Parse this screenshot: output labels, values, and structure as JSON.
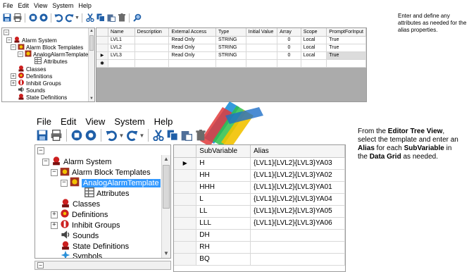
{
  "menu": [
    "File",
    "Edit",
    "View",
    "System",
    "Help"
  ],
  "toolbar": {
    "icons": [
      "save-icon",
      "print-icon",
      "stop-icon",
      "record-icon",
      "undo-icon",
      "redo-icon",
      "cut-icon",
      "copy-icon",
      "paste-icon",
      "delete-icon",
      "find-icon"
    ]
  },
  "top": {
    "tree": {
      "items": [
        {
          "label": "Alarm System",
          "icon": "alarm-icon"
        },
        {
          "label": "Alarm Block Templates",
          "icon": "template-folder-icon"
        },
        {
          "label": "AnalogAlarmTemplate",
          "icon": "template-icon"
        },
        {
          "label": "Attributes",
          "icon": "table-icon"
        },
        {
          "label": "Classes",
          "icon": "alarm-icon"
        },
        {
          "label": "Definitions",
          "icon": "definition-icon"
        },
        {
          "label": "Inhibit Groups",
          "icon": "inhibit-icon"
        },
        {
          "label": "Sounds",
          "icon": "speaker-icon"
        },
        {
          "label": "State Definitions",
          "icon": "state-icon"
        }
      ]
    },
    "grid": {
      "columns": [
        "Name",
        "Description",
        "External Access",
        "Type",
        "Initial Value",
        "Array",
        "Scope",
        "PromptForInput"
      ],
      "rows": [
        [
          "LVL1",
          "",
          "Read Only",
          "STRING",
          "",
          "0",
          "Local",
          "True"
        ],
        [
          "LVL2",
          "",
          "Read Only",
          "STRING",
          "",
          "0",
          "Local",
          "True"
        ],
        [
          "LVL3",
          "",
          "Read Only",
          "STRING",
          "",
          "0",
          "Local",
          "True"
        ]
      ],
      "current_row_marker": "▶",
      "new_row_marker": "✱"
    },
    "note": "Enter and define any attributes as needed for the alias properties."
  },
  "bottom": {
    "tree": {
      "items": [
        {
          "label": "Alarm System",
          "icon": "alarm-icon"
        },
        {
          "label": "Alarm Block Templates",
          "icon": "template-folder-icon"
        },
        {
          "label": "AnalogAlarmTemplate",
          "icon": "template-icon"
        },
        {
          "label": "Attributes",
          "icon": "table-icon"
        },
        {
          "label": "Classes",
          "icon": "alarm-icon"
        },
        {
          "label": "Definitions",
          "icon": "definition-icon"
        },
        {
          "label": "Inhibit Groups",
          "icon": "inhibit-icon"
        },
        {
          "label": "Sounds",
          "icon": "speaker-icon"
        },
        {
          "label": "State Definitions",
          "icon": "state-icon"
        },
        {
          "label": "Symbols",
          "icon": "symbols-icon"
        }
      ]
    },
    "grid": {
      "columns": [
        "SubVariable",
        "Alias"
      ],
      "rows": [
        [
          "H",
          "{LVL1}{LVL2}{LVL3}YA03"
        ],
        [
          "HH",
          "{LVL1}{LVL2}{LVL3}YA02"
        ],
        [
          "HHH",
          "{LVL1}{LVL2}{LVL3}YA01"
        ],
        [
          "L",
          "{LVL1}{LVL2}{LVL3}YA04"
        ],
        [
          "LL",
          "{LVL1}{LVL2}{LVL3}YA05"
        ],
        [
          "LLL",
          "{LVL1}{LVL2}{LVL3}YA06"
        ],
        [
          "DH",
          ""
        ],
        [
          "RH",
          ""
        ],
        [
          "BQ",
          ""
        ]
      ],
      "current_row_marker": "▶"
    },
    "note": {
      "p1": "From the ",
      "b1": "Editor Tree View",
      "p2": ", select the template and enter an ",
      "b2": "Alias",
      "p3": " for each ",
      "b3": "SubVariable",
      "p4": " in the ",
      "b4": "Data Grid",
      "p5": " as needed."
    }
  },
  "colors": {
    "selection": "#3399ff",
    "toolbar_blue": "#1f5fa8",
    "alarm_red": "#cc1f1f"
  }
}
